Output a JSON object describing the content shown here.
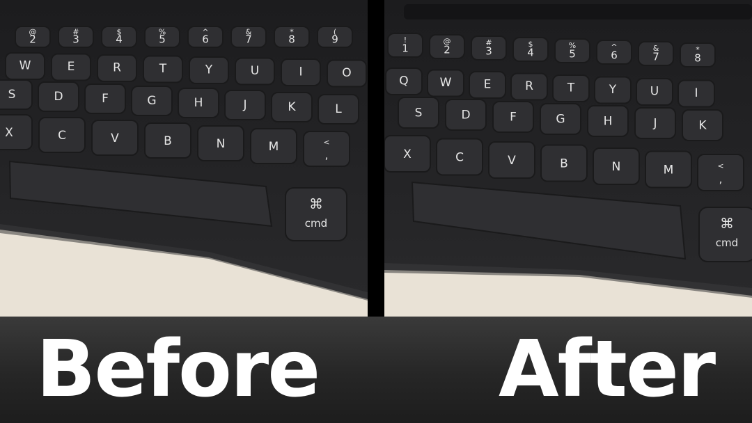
{
  "captions": {
    "before": "Before",
    "after": "After"
  },
  "colors": {
    "keyboard": "#242426",
    "key": "#2f2f32",
    "surface": "#e9e2d6",
    "caption_bar": "#2b2b2b",
    "caption_text": "#ffffff"
  },
  "before": {
    "rows": [
      [
        [
          "@",
          "2"
        ],
        [
          "#",
          "3"
        ],
        [
          "$",
          "4"
        ],
        [
          "%",
          "5"
        ],
        [
          "^",
          "6"
        ],
        [
          "&",
          "7"
        ],
        [
          "*",
          "8"
        ],
        [
          "(",
          "9"
        ]
      ],
      [
        [
          "",
          "W"
        ],
        [
          "",
          "E"
        ],
        [
          "",
          "R"
        ],
        [
          "",
          "T"
        ],
        [
          "",
          "Y"
        ],
        [
          "",
          "U"
        ],
        [
          "",
          "I"
        ],
        [
          "",
          "O"
        ]
      ],
      [
        [
          "",
          "S"
        ],
        [
          "",
          "D"
        ],
        [
          "",
          "F"
        ],
        [
          "",
          "G"
        ],
        [
          "",
          "H"
        ],
        [
          "",
          "J"
        ],
        [
          "",
          "K"
        ],
        [
          "",
          "L"
        ]
      ],
      [
        [
          "",
          "X"
        ],
        [
          "",
          "C"
        ],
        [
          "",
          "V"
        ],
        [
          "",
          "B"
        ],
        [
          "",
          "N"
        ],
        [
          "",
          "M"
        ],
        [
          "<",
          ","
        ]
      ]
    ],
    "cmd_symbol": "⌘",
    "cmd_label": "cmd"
  },
  "after": {
    "rows": [
      [
        [
          "!",
          "1"
        ],
        [
          "@",
          "2"
        ],
        [
          "#",
          "3"
        ],
        [
          "$",
          "4"
        ],
        [
          "%",
          "5"
        ],
        [
          "^",
          "6"
        ],
        [
          "&",
          "7"
        ],
        [
          "*",
          "8"
        ]
      ],
      [
        [
          "",
          "Q"
        ],
        [
          "",
          "W"
        ],
        [
          "",
          "E"
        ],
        [
          "",
          "R"
        ],
        [
          "",
          "T"
        ],
        [
          "",
          "Y"
        ],
        [
          "",
          "U"
        ],
        [
          "",
          "I"
        ]
      ],
      [
        [
          "",
          "S"
        ],
        [
          "",
          "D"
        ],
        [
          "",
          "F"
        ],
        [
          "",
          "G"
        ],
        [
          "",
          "H"
        ],
        [
          "",
          "J"
        ],
        [
          "",
          "K"
        ]
      ],
      [
        [
          "",
          "X"
        ],
        [
          "",
          "C"
        ],
        [
          "",
          "V"
        ],
        [
          "",
          "B"
        ],
        [
          "",
          "N"
        ],
        [
          "",
          "M"
        ],
        [
          "<",
          ","
        ]
      ]
    ],
    "cmd_symbol": "⌘",
    "cmd_label": "cmd"
  }
}
